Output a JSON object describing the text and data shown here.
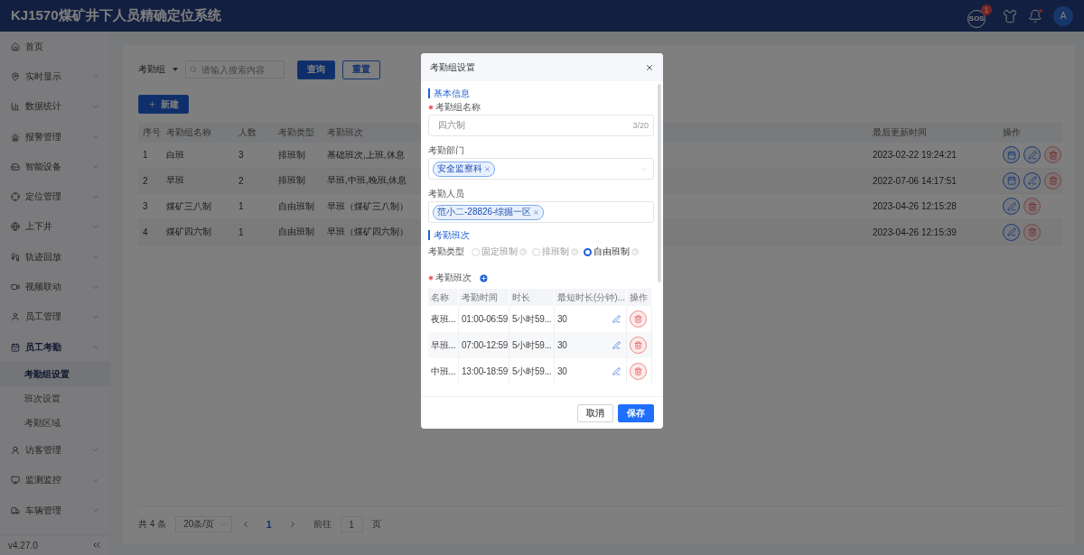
{
  "header": {
    "title": "KJ1570煤矿井下人员精确定位系统",
    "sos_label": "SOS",
    "sos_count": "1",
    "bell_unread": true,
    "avatar": "A"
  },
  "sidebar": {
    "items": [
      {
        "kind": "link",
        "label": "首页",
        "selected": false
      },
      {
        "kind": "group",
        "label": "实时显示",
        "selected": false,
        "expanded": false
      },
      {
        "kind": "group",
        "label": "数据统计",
        "selected": false,
        "expanded": false
      },
      {
        "kind": "group",
        "label": "报警管理",
        "selected": false,
        "expanded": false
      },
      {
        "kind": "group",
        "label": "智能设备",
        "selected": false,
        "expanded": false
      },
      {
        "kind": "group",
        "label": "定位管理",
        "selected": false,
        "expanded": false
      },
      {
        "kind": "group",
        "label": "上下井",
        "selected": false,
        "expanded": false
      },
      {
        "kind": "group",
        "label": "轨迹回放",
        "selected": false,
        "expanded": false
      },
      {
        "kind": "group",
        "label": "视频联动",
        "selected": false,
        "expanded": false
      },
      {
        "kind": "group",
        "label": "员工管理",
        "selected": false,
        "expanded": false
      },
      {
        "kind": "group",
        "label": "员工考勤",
        "selected": true,
        "expanded": true,
        "children": [
          {
            "label": "考勤组设置",
            "selected": true
          },
          {
            "label": "班次设置",
            "selected": false
          },
          {
            "label": "考勤区域",
            "selected": false
          }
        ]
      },
      {
        "kind": "group",
        "label": "访客管理",
        "selected": false,
        "expanded": false
      },
      {
        "kind": "group",
        "label": "监测监控",
        "selected": false,
        "expanded": false
      },
      {
        "kind": "group",
        "label": "车辆管理",
        "selected": false,
        "expanded": false
      }
    ],
    "version": "v4.27.0"
  },
  "filter": {
    "dropdown_label": "考勤组",
    "placeholder": "请输入搜索内容",
    "search_button": "查询",
    "reset_button": "重置"
  },
  "new_button": "新建",
  "table": {
    "columns": [
      "序号",
      "考勤组名称",
      "人数",
      "考勤类型",
      "考勤班次",
      "最后更新时间",
      "操作"
    ],
    "rows": [
      {
        "cells": [
          "1",
          "白班",
          "3",
          "排班制",
          "基础班次,上班,休息",
          "2023-02-22 19:24:21"
        ],
        "actions": [
          {
            "kind": "calendar"
          },
          {
            "kind": "edit"
          },
          {
            "kind": "delete"
          }
        ]
      },
      {
        "cells": [
          "2",
          "早班",
          "2",
          "排班制",
          "早班,中班,晚班,休息",
          "2022-07-06 14:17:51"
        ],
        "actions": [
          {
            "kind": "calendar"
          },
          {
            "kind": "edit"
          },
          {
            "kind": "delete"
          }
        ]
      },
      {
        "cells": [
          "3",
          "煤矿三八制",
          "1",
          "自由班制",
          "早班（煤矿三八制）",
          "2023-04-26 12:15:28"
        ],
        "actions": [
          {
            "kind": "edit"
          },
          {
            "kind": "delete"
          }
        ]
      },
      {
        "cells": [
          "4",
          "煤矿四六制",
          "1",
          "自由班制",
          "早班（煤矿四六制）",
          "2023-04-26 12:15:39"
        ],
        "actions": [
          {
            "kind": "edit"
          },
          {
            "kind": "delete"
          }
        ]
      }
    ]
  },
  "pagination": {
    "total": "共 4 条",
    "page_size": "20条/页",
    "current_page": "1",
    "goto_label": "前往",
    "goto_value": "1",
    "goto_suffix": "页"
  },
  "dialog": {
    "title": "考勤组设置",
    "section_basic": "基本信息",
    "name_field": {
      "label": "考勤组名称",
      "required": true,
      "value": "四六制",
      "counter": "3/20"
    },
    "department_field": {
      "label": "考勤部门",
      "tags": [
        "安全监察科"
      ]
    },
    "staff_field": {
      "label": "考勤人员",
      "tags": [
        "范小二-28826-综掘一区"
      ]
    },
    "section_shift": "考勤班次",
    "type_field": {
      "label": "考勤类型",
      "options": [
        {
          "label": "固定班制",
          "selected": false
        },
        {
          "label": "排班制",
          "selected": false
        },
        {
          "label": "自由班制",
          "selected": true
        }
      ]
    },
    "shifts": {
      "label": "考勤班次",
      "required": true,
      "columns": [
        "名称",
        "考勤时间",
        "时长",
        "最短时长(分钟)...",
        "操作"
      ],
      "rows": [
        {
          "cells": [
            "夜班...",
            "01:00-06:59",
            "5小时59...",
            "30"
          ]
        },
        {
          "cells": [
            "早班...",
            "07:00-12:59",
            "5小时59...",
            "30"
          ]
        },
        {
          "cells": [
            "中班...",
            "13:00-18:59",
            "5小时59...",
            "30"
          ]
        }
      ]
    },
    "cancel_button": "取消",
    "save_button": "保存"
  }
}
